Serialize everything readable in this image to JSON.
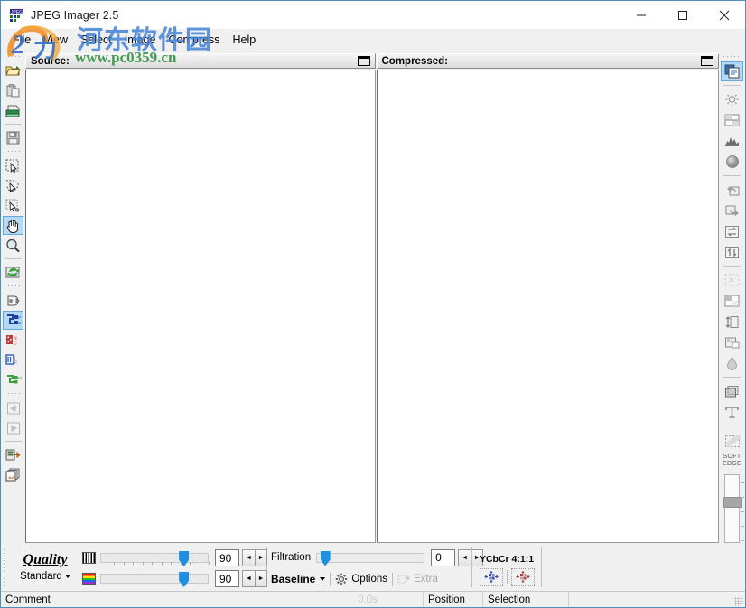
{
  "window": {
    "title": "JPEG Imager 2.5",
    "app_icon": "jpeg-imager-icon",
    "minimize": "—",
    "maximize": "□",
    "close": "✕"
  },
  "menubar": {
    "items": [
      {
        "label": "File"
      },
      {
        "label": "View"
      },
      {
        "label": "Select"
      },
      {
        "label": "Image"
      },
      {
        "label": "Compress"
      },
      {
        "label": "Help"
      }
    ]
  },
  "watermark": {
    "chinese": "河东软件园",
    "url": "www.pc0359.cn",
    "logo_color": "#3d7fd6",
    "url_color": "#2f8f3f"
  },
  "left_toolbar": {
    "groups": [
      {
        "items": [
          {
            "icon": "open-folder-icon",
            "label": "Open"
          },
          {
            "icon": "paste-clipboard-icon",
            "label": "Paste"
          },
          {
            "icon": "print-icon",
            "label": "Print"
          }
        ]
      },
      {
        "items": [
          {
            "icon": "save-disk-icon",
            "label": "Save"
          }
        ]
      },
      {
        "items": [
          {
            "icon": "select-rect-icon",
            "label": "Rectangular Select"
          },
          {
            "icon": "select-free-icon",
            "label": "Freehand Select"
          },
          {
            "icon": "select-magic-icon",
            "label": "Magic Select"
          },
          {
            "icon": "hand-pan-icon",
            "label": "Pan",
            "active": true
          },
          {
            "icon": "magnifier-zoom-icon",
            "label": "Zoom"
          }
        ]
      },
      {
        "items": [
          {
            "icon": "refresh-image-icon",
            "label": "Refresh"
          }
        ]
      },
      {
        "items": [
          {
            "icon": "fill-bucket-icon",
            "label": "Fill"
          },
          {
            "icon": "blue-quality-icon",
            "label": "Quality Map",
            "active": true
          },
          {
            "icon": "red-noise-icon",
            "label": "Noise Map"
          },
          {
            "icon": "green-edge-icon",
            "label": "Edge Map"
          },
          {
            "icon": "green-kb-icon",
            "label": "Size Map"
          }
        ]
      },
      {
        "items": [
          {
            "icon": "undo-arrow-icon",
            "label": "Undo",
            "disabled": true
          },
          {
            "icon": "redo-arrow-icon",
            "label": "Redo",
            "disabled": true
          }
        ]
      },
      {
        "items": [
          {
            "icon": "export-icon",
            "label": "Export"
          },
          {
            "icon": "batch-copies-icon",
            "label": "Batch"
          }
        ]
      }
    ]
  },
  "right_toolbar": {
    "groups": [
      {
        "items": [
          {
            "icon": "duplicate-window-icon",
            "label": "Duplicate",
            "active": true
          }
        ]
      },
      {
        "items": [
          {
            "icon": "brightness-icon",
            "label": "Brightness"
          },
          {
            "icon": "levels-icon",
            "label": "Levels"
          },
          {
            "icon": "histogram-icon",
            "label": "Histogram"
          },
          {
            "icon": "sphere-gradient-icon",
            "label": "Gradient"
          }
        ]
      },
      {
        "items": [
          {
            "icon": "rotate-left-icon",
            "label": "Rotate Left"
          },
          {
            "icon": "rotate-right-icon",
            "label": "Rotate Right"
          },
          {
            "icon": "flip-horizontal-icon",
            "label": "Flip Horizontal"
          },
          {
            "icon": "flip-vertical-icon",
            "label": "Flip Vertical"
          }
        ]
      },
      {
        "items": [
          {
            "icon": "marquee-dashed-icon",
            "label": "Marquee",
            "disabled": true
          },
          {
            "icon": "crop-icon",
            "label": "Crop"
          },
          {
            "icon": "resize-icon",
            "label": "Resize"
          },
          {
            "icon": "canvas-size-icon",
            "label": "Canvas Size"
          },
          {
            "icon": "water-drop-icon",
            "label": "Blur"
          }
        ]
      },
      {
        "items": [
          {
            "icon": "texture-icon",
            "label": "Texture"
          },
          {
            "icon": "text-tool-icon",
            "label": "Text"
          }
        ]
      },
      {
        "items": [
          {
            "icon": "soft-edge-selection-icon",
            "label": "Soft Edge Selection"
          }
        ]
      }
    ],
    "soft_edge": {
      "line1": "SOFT",
      "line2": "EDGE"
    },
    "slider": {
      "value": 32
    }
  },
  "panes": {
    "source": {
      "title": "Source:",
      "restore_icon": "restore-window-icon"
    },
    "compressed": {
      "title": "Compressed:",
      "restore_icon": "restore-window-icon"
    }
  },
  "control_panel": {
    "quality": {
      "title": "Quality",
      "preset": "Standard",
      "preset_caret": "caret-down-icon",
      "sliders": [
        {
          "icon": "grayscale-swatch-icon",
          "value": "90",
          "position_pct": 73
        },
        {
          "icon": "color-swatch-icon",
          "value": "90",
          "position_pct": 73
        }
      ],
      "spin_left": "◄",
      "spin_right": "►"
    },
    "filtration": {
      "label": "Filtration",
      "value": "0",
      "position_pct": 3,
      "mode": "Baseline",
      "mode_caret": "caret-down-icon",
      "options_label": "Options",
      "options_icon": "gear-icon",
      "extra_label": "Extra",
      "extra_icon": "extra-icon",
      "extra_disabled": true
    },
    "ycbcr": {
      "label": "YCbCr 4:1:1",
      "buttons": [
        {
          "icon": "chroma-blue-icon",
          "color": "#3a4ba8"
        },
        {
          "icon": "chroma-red-icon",
          "color": "#a04a4a"
        }
      ]
    }
  },
  "statusbar": {
    "comment": "Comment",
    "time": "0.0s",
    "position": "Position",
    "selection": "Selection",
    "resize_grip": "resize-grip-icon"
  }
}
